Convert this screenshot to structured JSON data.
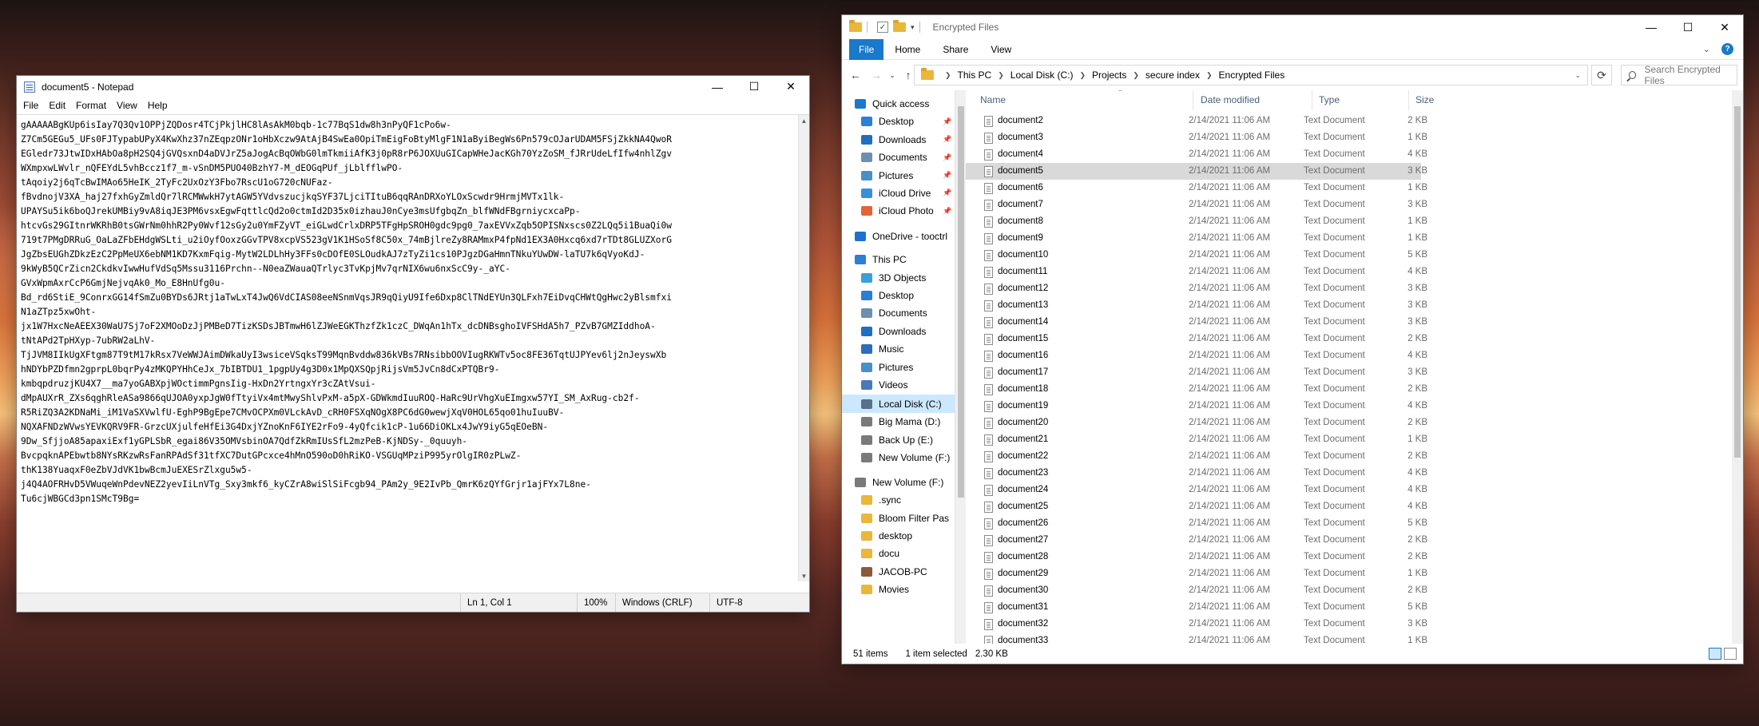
{
  "notepad": {
    "title": "document5 - Notepad",
    "caption_buttons": [
      "—",
      "☐",
      "✕"
    ],
    "menu": [
      "File",
      "Edit",
      "Format",
      "View",
      "Help"
    ],
    "lines": [
      "gAAAAABgKUp6isIay7Q3Qv1OPPjZQDosr4TCjPkjlHC8lAsAkM0bqb-1c77BqS1dw8h3nPyQF1cPo6w-",
      "Z7Cm5GEGu5_UFs0FJTypabUPyX4KwXhz37nZEqpzONr1oHbXczw9AtAjB4SwEa0OpiTmEigFoBtyMlgF1N1aByiBegWs6Pn579cOJarUDAM5FSjZkkNA4QwoR",
      "EGledr73JtwIDxHAbOa8pH2SQ4jGVQsxnD4aDVJrZ5aJogAcBqOWbG0lmTkmiiAfK3j0pR8rP6JOXUuGICapWHeJacKGh70YzZoSM_fJRrUdeLfIfw4nhlZgv",
      "WXmpxwLWvlr_nQFEYdL5vhBccz1f7_m-vSnDM5PUO40BzhY7-M_dEOGqPUf_jLblfflwPO-",
      "tAqoiy2j6qTcBwIMAo65HeIK_2TyFc2UxOzY3Fbo7RscU1oG720cNUFaz-",
      "fBvdnojV3XA_haj27fxhGyZmldQr7lRCMWwkH7ytAGW5YVdvszucjkqSYF37LjciTItuB6qqRAnDRXoYLOxScwdr9HrmjMVTx1lk-",
      "UPAYSu5ik6boQJrekUMBiy9vA8iqJE3PM6vsxEgwFqttlcQd2o0ctmId2D35x0izhauJ0nCye3msUfgbqZn_blfWNdFBgrniycxcaPp-",
      "htcvGs29GItnrWKRhB0tsGWrNm0hhR2Py0Wvf12sGy2u0YmFZyVT_eiGLwdCrlxDRP5TFgHpSROH0gdc9pg0_7axEVVxZqb5OPISNxscs0Z2LQq5i1BuaQi0w",
      "719t7PMgDRRuG_OaLaZFbEHdgWSLti_u2iOyfOoxzGGvTPV8xcpVS523gV1K1HSoSf8C50x_74mBjlreZy8RAMmxP4fpNd1EX3A0Hxcq6xd7rTDt8GLUZXorG",
      "JgZbsEUGhZDkzEzC2PpMeUX6ebNM1KD7KxmFqig-MytW2LDLhHy3FFs0cDOfE0SLOudkAJ7zTyZi1cs10PJgzDGaHmnTNkuYUwDW-laTU7k6qVyoKdJ-",
      "9kWyB5QCrZicn2CkdkvIwwHufVdSq5Mssu3116Prchn--N0eaZWauaQTrlyc3TvKpjMv7qrNIX6wu6nxScC9y-_aYC-",
      "GVxWpmAxrCcP6GmjNejvqAk0_Mo_E8HnUfg0u-",
      "Bd_rd6StiE_9ConrxGG14fSmZu0BYDs6JRtj1aTwLxT4JwQ6VdCIAS08eeNSnmVqsJR9qQiyU9Ife6Dxp8ClTNdEYUn3QLFxh7EiDvqCHWtQgHwc2yBlsmfxi",
      "N1aZTpz5xwOht-",
      "jx1W7HxcNeAEEX30WaU7Sj7oF2XMOoDzJjPMBeD7TizKSDsJBTmwH6lZJWeEGKThzfZk1czC_DWqAn1hTx_dcDNBsghoIVFSHdA5h7_PZvB7GMZIddhoA-",
      "tNtAPd2TpHXyp-7ubRW2aLhV-",
      "TjJVM8IIkUgXFtgm87T9tM17kRsx7VeWWJAimDWkaUyI3wsiceVSqksT99MqnBvddw836kVBs7RNsibbOOVIugRKWTv5oc8FE36TqtUJPYev6lj2nJeyswXb",
      "hNDYbPZDfmn2gprpL0bqrPy4zMKQPYHhCeJx_7bIBTDU1_1pgpUy4g3D0x1MpQXSQpjRijsVm5JvCn8dCxPTQBr9-",
      "kmbqpdruzjKU4X7__ma7yoGABXpjWOctimmPgnsIig-HxDn2YrtngxYr3cZAtVsui-",
      "dMpAUXrR_ZXs6qghRleASa9866qUJOA0yxpJgW0fTtyiVx4mtMwyShlvPxM-a5pX-GDWkmdIuuROQ-HaRc9UrVhgXuEImgxw57YI_SM_AxRug-cb2f-",
      "R5RiZQ3A2KDNaMi_iM1VaSXVwlfU-EghP9BgEpe7CMvOCPXm0VLckAvD_cRH0FSXqNOgX8PC6dG0wewjXqV0HOL65qo01huIuuBV-",
      "NQXAFNDzWVwsYEVKQRV9FR-GrzcUXjulfeHfEi3G4DxjYZnoKnF6IYE2rFo9-4yQfcik1cP-1u66DiOKLx4JwY9iyG5qEOeBN-",
      "9Dw_SfjjoA85apaxiExf1yGPLSbR_egai86V35OMVsbinOA7QdfZkRmIUsSfL2mzPeB-KjNDSy-_0quuyh-",
      "BvcpqknAPEbwtb8NYsRKzwRsFanRPAdSf31tfXC7DutGPcxce4hMnO590oD0hRiKO-VSGUqMPziP995yrOlgIR0zPLwZ-",
      "thK138YuaqxF0eZbVJdVK1bwBcmJuEXESrZlxgu5w5-",
      "j4Q4AOFRHvD5VWuqeWnPdevNEZ2yevIiLnVTg_Sxy3mkf6_kyCZrA8wiSlSiFcgb94_PAm2y_9E2IvPb_QmrK6zQYfGrjr1ajFYx7L8ne-",
      "Tu6cjWBGCd3pn1SMcT9Bg="
    ],
    "status": {
      "position": "Ln 1, Col 1",
      "zoom": "100%",
      "line_ending": "Windows (CRLF)",
      "encoding": "UTF-8"
    }
  },
  "explorer": {
    "title": "Encrypted Files",
    "caption_buttons": [
      "—",
      "☐",
      "✕"
    ],
    "ribbon": [
      "File",
      "Home",
      "Share",
      "View"
    ],
    "breadcrumb": [
      "This PC",
      "Local Disk (C:)",
      "Projects",
      "secure index",
      "Encrypted Files"
    ],
    "search_placeholder": "Search Encrypted Files",
    "columns": [
      "Name",
      "Date modified",
      "Type",
      "Size"
    ],
    "nav": [
      {
        "label": "Quick access",
        "icon": "star-icon",
        "color": "#1979ca",
        "pinned": false
      },
      {
        "label": "Desktop",
        "icon": "desktop-icon",
        "color": "#2b7fd4",
        "pinned": true
      },
      {
        "label": "Downloads",
        "icon": "download-icon",
        "color": "#1f6fc0",
        "pinned": true
      },
      {
        "label": "Documents",
        "icon": "documents-icon",
        "color": "#6f8fae",
        "pinned": true
      },
      {
        "label": "Pictures",
        "icon": "pictures-icon",
        "color": "#4a90c8",
        "pinned": true
      },
      {
        "label": "iCloud Drive",
        "icon": "cloud-icon",
        "color": "#3a8fd8",
        "pinned": true
      },
      {
        "label": "iCloud Photo",
        "icon": "photos-icon",
        "color": "#e0653a",
        "pinned": true
      },
      {
        "label": "OneDrive - tooctrl",
        "icon": "onedrive-icon",
        "color": "#1f6fd0",
        "pinned": false
      },
      {
        "label": "This PC",
        "icon": "pc-icon",
        "color": "#2b7fd4",
        "pinned": false
      },
      {
        "label": "3D Objects",
        "icon": "cube-icon",
        "color": "#3aa0d8",
        "pinned": false
      },
      {
        "label": "Desktop",
        "icon": "desktop-icon",
        "color": "#2b7fd4",
        "pinned": false
      },
      {
        "label": "Documents",
        "icon": "documents-icon",
        "color": "#6f8fae",
        "pinned": false
      },
      {
        "label": "Downloads",
        "icon": "download-icon",
        "color": "#1f6fc0",
        "pinned": false
      },
      {
        "label": "Music",
        "icon": "music-icon",
        "color": "#2b6fb8",
        "pinned": false
      },
      {
        "label": "Pictures",
        "icon": "pictures-icon",
        "color": "#4a90c8",
        "pinned": false
      },
      {
        "label": "Videos",
        "icon": "videos-icon",
        "color": "#4a78b8",
        "pinned": false
      },
      {
        "label": "Local Disk (C:)",
        "icon": "drive-icon",
        "color": "#5a6f8a",
        "pinned": false
      },
      {
        "label": "Big Mama (D:)",
        "icon": "drive-icon",
        "color": "#7a7a7a",
        "pinned": false
      },
      {
        "label": "Back Up (E:)",
        "icon": "drive-icon",
        "color": "#7a7a7a",
        "pinned": false
      },
      {
        "label": "New Volume (F:)",
        "icon": "drive-icon",
        "color": "#7a7a7a",
        "pinned": false
      },
      {
        "label": "New Volume (F:)",
        "icon": "drive-icon",
        "color": "#7a7a7a",
        "pinned": false
      },
      {
        "label": ".sync",
        "icon": "folder-icon",
        "color": "#e8b73b",
        "pinned": false
      },
      {
        "label": "Bloom Filter Pas",
        "icon": "folder-icon",
        "color": "#e8b73b",
        "pinned": false
      },
      {
        "label": "desktop",
        "icon": "folder-icon",
        "color": "#e8b73b",
        "pinned": false
      },
      {
        "label": "docu",
        "icon": "folder-icon",
        "color": "#e8b73b",
        "pinned": false
      },
      {
        "label": "JACOB-PC",
        "icon": "user-icon",
        "color": "#8a5a3a",
        "pinned": false
      },
      {
        "label": "Movies",
        "icon": "folder-icon",
        "color": "#e8b73b",
        "pinned": false
      }
    ],
    "files": [
      {
        "name": "document2",
        "date": "2/14/2021 11:06 AM",
        "type": "Text Document",
        "size": "2 KB"
      },
      {
        "name": "document3",
        "date": "2/14/2021 11:06 AM",
        "type": "Text Document",
        "size": "1 KB"
      },
      {
        "name": "document4",
        "date": "2/14/2021 11:06 AM",
        "type": "Text Document",
        "size": "4 KB"
      },
      {
        "name": "document5",
        "date": "2/14/2021 11:06 AM",
        "type": "Text Document",
        "size": "3 KB"
      },
      {
        "name": "document6",
        "date": "2/14/2021 11:06 AM",
        "type": "Text Document",
        "size": "1 KB"
      },
      {
        "name": "document7",
        "date": "2/14/2021 11:06 AM",
        "type": "Text Document",
        "size": "3 KB"
      },
      {
        "name": "document8",
        "date": "2/14/2021 11:06 AM",
        "type": "Text Document",
        "size": "1 KB"
      },
      {
        "name": "document9",
        "date": "2/14/2021 11:06 AM",
        "type": "Text Document",
        "size": "1 KB"
      },
      {
        "name": "document10",
        "date": "2/14/2021 11:06 AM",
        "type": "Text Document",
        "size": "5 KB"
      },
      {
        "name": "document11",
        "date": "2/14/2021 11:06 AM",
        "type": "Text Document",
        "size": "4 KB"
      },
      {
        "name": "document12",
        "date": "2/14/2021 11:06 AM",
        "type": "Text Document",
        "size": "3 KB"
      },
      {
        "name": "document13",
        "date": "2/14/2021 11:06 AM",
        "type": "Text Document",
        "size": "3 KB"
      },
      {
        "name": "document14",
        "date": "2/14/2021 11:06 AM",
        "type": "Text Document",
        "size": "3 KB"
      },
      {
        "name": "document15",
        "date": "2/14/2021 11:06 AM",
        "type": "Text Document",
        "size": "2 KB"
      },
      {
        "name": "document16",
        "date": "2/14/2021 11:06 AM",
        "type": "Text Document",
        "size": "4 KB"
      },
      {
        "name": "document17",
        "date": "2/14/2021 11:06 AM",
        "type": "Text Document",
        "size": "3 KB"
      },
      {
        "name": "document18",
        "date": "2/14/2021 11:06 AM",
        "type": "Text Document",
        "size": "2 KB"
      },
      {
        "name": "document19",
        "date": "2/14/2021 11:06 AM",
        "type": "Text Document",
        "size": "4 KB"
      },
      {
        "name": "document20",
        "date": "2/14/2021 11:06 AM",
        "type": "Text Document",
        "size": "2 KB"
      },
      {
        "name": "document21",
        "date": "2/14/2021 11:06 AM",
        "type": "Text Document",
        "size": "1 KB"
      },
      {
        "name": "document22",
        "date": "2/14/2021 11:06 AM",
        "type": "Text Document",
        "size": "2 KB"
      },
      {
        "name": "document23",
        "date": "2/14/2021 11:06 AM",
        "type": "Text Document",
        "size": "4 KB"
      },
      {
        "name": "document24",
        "date": "2/14/2021 11:06 AM",
        "type": "Text Document",
        "size": "4 KB"
      },
      {
        "name": "document25",
        "date": "2/14/2021 11:06 AM",
        "type": "Text Document",
        "size": "4 KB"
      },
      {
        "name": "document26",
        "date": "2/14/2021 11:06 AM",
        "type": "Text Document",
        "size": "5 KB"
      },
      {
        "name": "document27",
        "date": "2/14/2021 11:06 AM",
        "type": "Text Document",
        "size": "2 KB"
      },
      {
        "name": "document28",
        "date": "2/14/2021 11:06 AM",
        "type": "Text Document",
        "size": "2 KB"
      },
      {
        "name": "document29",
        "date": "2/14/2021 11:06 AM",
        "type": "Text Document",
        "size": "1 KB"
      },
      {
        "name": "document30",
        "date": "2/14/2021 11:06 AM",
        "type": "Text Document",
        "size": "2 KB"
      },
      {
        "name": "document31",
        "date": "2/14/2021 11:06 AM",
        "type": "Text Document",
        "size": "5 KB"
      },
      {
        "name": "document32",
        "date": "2/14/2021 11:06 AM",
        "type": "Text Document",
        "size": "3 KB"
      },
      {
        "name": "document33",
        "date": "2/14/2021 11:06 AM",
        "type": "Text Document",
        "size": "1 KB"
      }
    ],
    "selected_file": "document5",
    "status": {
      "item_count": "51 items",
      "selection": "1 item selected",
      "selection_size": "2.30 KB"
    }
  }
}
